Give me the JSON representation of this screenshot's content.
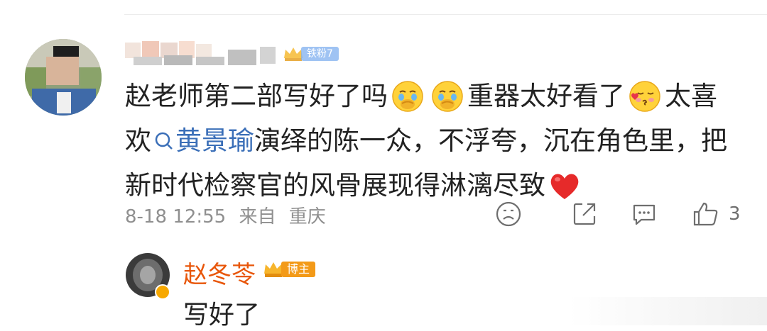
{
  "comment": {
    "username_redacted": true,
    "fan_badge": "铁粉7",
    "text_line1_a": "赵老师第二部写好了吗",
    "text_line1_b": "重器太好看了",
    "text_line1_c": "太喜",
    "text_line2_a": "欢",
    "text_line2_mention": "黄景瑜",
    "text_line2_b": "演绎的陈一众，不浮夸，沉在角色里，把",
    "text_line3": "新时代检察官的风骨展现得淋漓尽致",
    "emoji_1": "crying-emoji",
    "emoji_2": "crying-emoji",
    "emoji_3": "kiss-emoji",
    "emoji_4": "red-heart",
    "time": "8-18 12:55",
    "source": "来自",
    "location": "重庆",
    "like_count": "3"
  },
  "reply": {
    "name": "赵冬苓",
    "badge": "博主",
    "text": "写好了"
  },
  "colors": {
    "mention": "#3b6fb8",
    "reply_name": "#e8560a",
    "badge_orange": "#f39a18",
    "meta_gray": "#8f8f8f"
  }
}
